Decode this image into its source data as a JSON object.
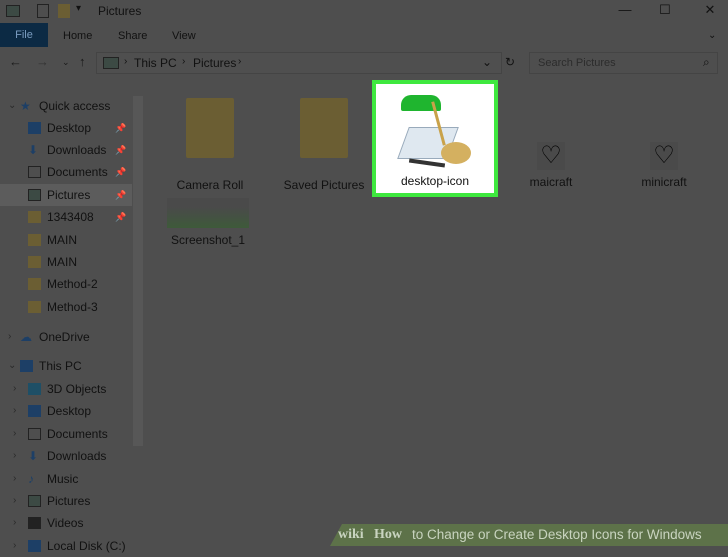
{
  "window": {
    "title": "Pictures",
    "minimize": "—",
    "maximize": "☐",
    "close": "✕"
  },
  "ribbon": {
    "file": "File",
    "home": "Home",
    "share": "Share",
    "view": "View"
  },
  "address": {
    "crumbs": [
      "This PC",
      "Pictures"
    ],
    "search_placeholder": "Search Pictures"
  },
  "sidebar": {
    "quick_access": "Quick access",
    "quick_items": [
      {
        "label": "Desktop",
        "pinned": true
      },
      {
        "label": "Downloads",
        "pinned": true
      },
      {
        "label": "Documents",
        "pinned": true
      },
      {
        "label": "Pictures",
        "pinned": true
      },
      {
        "label": "1343408",
        "pinned": true
      },
      {
        "label": "MAIN"
      },
      {
        "label": "MAIN"
      },
      {
        "label": "Method-2"
      },
      {
        "label": "Method-3"
      }
    ],
    "onedrive": "OneDrive",
    "this_pc": "This PC",
    "pc_items": [
      "3D Objects",
      "Desktop",
      "Documents",
      "Downloads",
      "Music",
      "Pictures",
      "Videos",
      "Local Disk (C:)"
    ]
  },
  "files": [
    {
      "name": "Camera Roll",
      "type": "folder"
    },
    {
      "name": "Saved Pictures",
      "type": "folder"
    },
    {
      "name": "desktop-icon",
      "type": "image",
      "highlighted": true
    },
    {
      "name": "maicraft",
      "type": "icon"
    },
    {
      "name": "minicraft",
      "type": "icon"
    },
    {
      "name": "Screenshot_1",
      "type": "image"
    }
  ],
  "banner": {
    "wiki": "wiki",
    "how": "How",
    "title": "to Change or Create Desktop Icons for Windows"
  },
  "colors": {
    "highlight": "#3ee83e",
    "banner": "#5d7249"
  }
}
